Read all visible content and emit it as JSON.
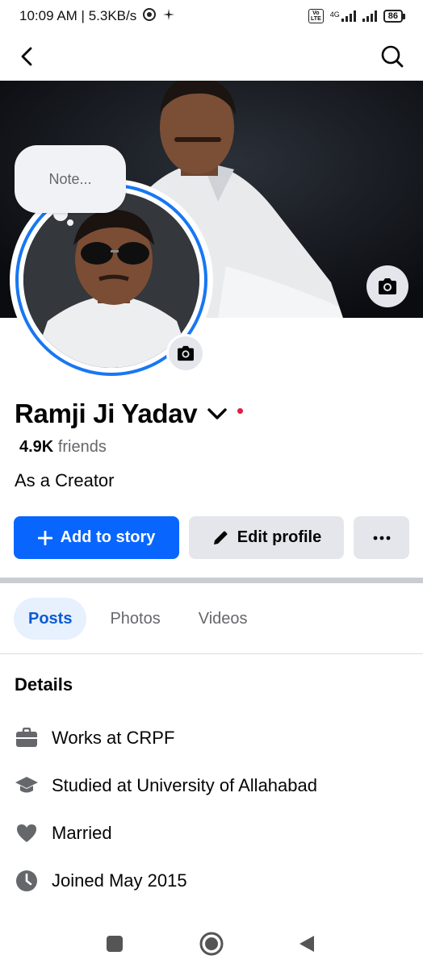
{
  "status_bar": {
    "time_speed": "10:09 AM | 5.3KB/s",
    "network_type": "4G",
    "volte_label": "Vo\nLTE",
    "battery": "86"
  },
  "nav": {
    "back_icon": "chevron-left-icon",
    "search_icon": "search-icon"
  },
  "note": {
    "placeholder": "Note..."
  },
  "profile": {
    "name": "Ramji Ji Yadav",
    "friends_count": "4.9K",
    "friends_label": "friends",
    "bio": "As a Creator"
  },
  "actions": {
    "add_story": "Add to story",
    "edit_profile": "Edit profile",
    "more_icon": "ellipsis-icon"
  },
  "tabs": [
    {
      "label": "Posts",
      "active": true
    },
    {
      "label": "Photos",
      "active": false
    },
    {
      "label": "Videos",
      "active": false
    }
  ],
  "details": {
    "title": "Details",
    "items": [
      {
        "icon": "briefcase-icon",
        "text": "Works at CRPF"
      },
      {
        "icon": "graduation-cap-icon",
        "text": "Studied at University of Allahabad"
      },
      {
        "icon": "heart-icon",
        "text": "Married"
      },
      {
        "icon": "clock-icon",
        "text": "Joined May 2015"
      }
    ]
  },
  "colors": {
    "primary": "#0866ff",
    "story_ring": "#1877f2",
    "secondary_button": "#e4e6eb",
    "active_tab_bg": "#e7f0fd",
    "active_tab_text": "#0a5bd3",
    "muted_text": "#65676b"
  }
}
